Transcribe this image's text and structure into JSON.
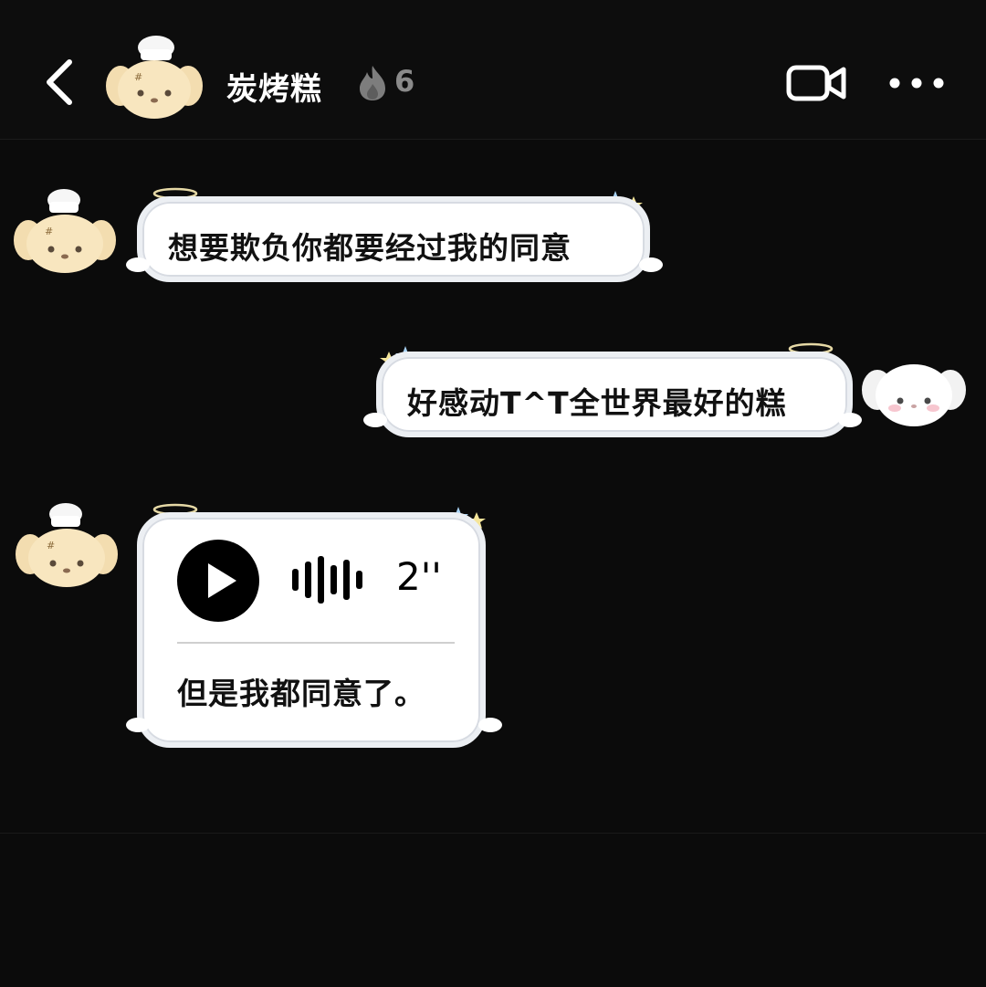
{
  "header": {
    "contact_name": "炭烤糕",
    "streak_count": "6",
    "icons": [
      "back-icon",
      "flame-icon",
      "video-call-icon",
      "more-icon"
    ]
  },
  "messages": [
    {
      "sender": "contact",
      "type": "text",
      "text": "想要欺负你都要经过我的同意"
    },
    {
      "sender": "self",
      "type": "text",
      "text": "好感动T^T全世界最好的糕"
    },
    {
      "sender": "contact",
      "type": "voice",
      "duration": "2''",
      "transcript": "但是我都同意了。"
    }
  ],
  "colors": {
    "background": "#0b0b0b",
    "bubble": "#ffffff",
    "bubble_border": "#eceff3",
    "text": "#111111",
    "streak_gray": "#8a8a8a"
  }
}
